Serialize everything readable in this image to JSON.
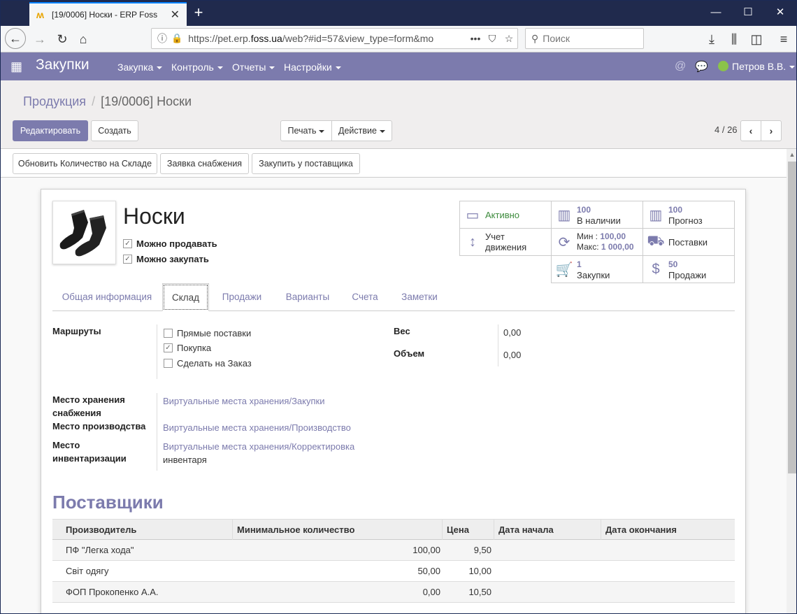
{
  "browser": {
    "tab_title": "[19/0006] Носки - ERP Foss",
    "url_prefix": "https://pet.erp.",
    "url_domain": "foss.ua",
    "url_rest": "/web?#id=57&view_type=form&mo",
    "search_placeholder": "Поиск"
  },
  "app": {
    "name": "Закупки",
    "menus": [
      "Закупка",
      "Контроль",
      "Отчеты",
      "Настройки"
    ],
    "user": "Петров В.В."
  },
  "breadcrumb": {
    "parent": "Продукция",
    "current": "[19/0006] Носки"
  },
  "buttons": {
    "edit": "Редактировать",
    "create": "Создать",
    "print": "Печать",
    "action": "Действие"
  },
  "pager": {
    "text": "4 / 26"
  },
  "actions": [
    "Обновить Количество на Складе",
    "Заявка снабжения",
    "Закупить у поставщика"
  ],
  "product": {
    "name": "Носки",
    "can_sell_label": "Можно продавать",
    "can_purchase_label": "Можно закупать",
    "can_sell": true,
    "can_purchase": true
  },
  "smart": {
    "active": "Активно",
    "on_hand_num": "100",
    "on_hand_label": "В наличии",
    "forecast_num": "100",
    "forecast_label": "Прогноз",
    "moves_line1": "Учет",
    "moves_line2": "движения",
    "min_label": "Мин :",
    "min_val": "100,00",
    "max_label": "Макс:",
    "max_val": "1 000,00",
    "deliveries": "Поставки",
    "purchases_num": "1",
    "purchases_label": "Закупки",
    "sales_num": "50",
    "sales_label": "Продажи"
  },
  "tabs": [
    "Общая информация",
    "Склад",
    "Продажи",
    "Варианты",
    "Счета",
    "Заметки"
  ],
  "active_tab": "Склад",
  "inventory": {
    "routes_label": "Маршруты",
    "routes": [
      {
        "label": "Прямые поставки",
        "checked": false
      },
      {
        "label": "Покупка",
        "checked": true
      },
      {
        "label": "Сделать на Заказ",
        "checked": false
      }
    ],
    "weight_label": "Вес",
    "weight": "0,00",
    "volume_label": "Объем",
    "volume": "0,00",
    "proc_loc_label_1": "Место хранения",
    "proc_loc_label_2": "снабжения",
    "proc_loc": "Виртуальные места хранения/Закупки",
    "prod_loc_label": "Место производства",
    "prod_loc": "Виртуальные места хранения/Производство",
    "inv_loc_label_1": "Место",
    "inv_loc_label_2": "инвентаризации",
    "inv_loc_1": "Виртуальные места хранения/Корректировка",
    "inv_loc_2": "инвентаря"
  },
  "vendors": {
    "title": "Поставщики",
    "columns": [
      "Производитель",
      "Минимальное количество",
      "Цена",
      "Дата начала",
      "Дата окончания"
    ],
    "rows": [
      {
        "vendor": "ПФ \"Легка хода\"",
        "min_qty": "100,00",
        "price": "9,50"
      },
      {
        "vendor": "Світ одягу",
        "min_qty": "50,00",
        "price": "10,00"
      },
      {
        "vendor": "ФОП Прокопенко А.А.",
        "min_qty": "0,00",
        "price": "10,50"
      }
    ]
  },
  "colors": {
    "brand": "#7c7bad",
    "active_green": "#3d8b3d"
  }
}
